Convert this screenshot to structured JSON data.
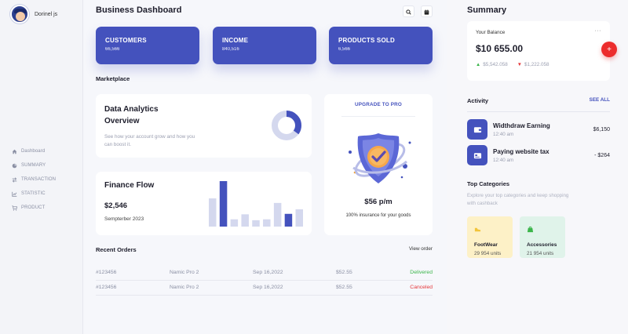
{
  "sidebar": {
    "profile_name": "Dorinel js",
    "items": [
      {
        "label": "Dashboard",
        "icon": "home-icon"
      },
      {
        "label": "SUMMARY",
        "icon": "pie-icon"
      },
      {
        "label": "TRANSACTION",
        "icon": "swap-icon"
      },
      {
        "label": "STATISTIC",
        "icon": "chart-icon"
      },
      {
        "label": "PRODUCT",
        "icon": "cart-icon"
      }
    ]
  },
  "header": {
    "title": "Business Dashboard",
    "actions": [
      {
        "icon": "search-icon"
      },
      {
        "icon": "calendar-icon"
      }
    ]
  },
  "stats": [
    {
      "label": "CUSTOMERS",
      "value": "66,566"
    },
    {
      "label": "INCOME",
      "value": "840,516"
    },
    {
      "label": "PRODUCTS SOLD",
      "value": "6,566"
    }
  ],
  "marketplace": {
    "label": "Marketplace",
    "analytics": {
      "title_line1": "Data Analytics",
      "title_line2": "Overview",
      "description": "See how your account grow and how you can boost it.",
      "donut_fraction": 0.35
    },
    "finance": {
      "title": "Finance Flow",
      "amount": "$2,546",
      "period": "Sempterber 2023",
      "bar_levels": [
        0.62,
        1.0,
        0.16,
        0.27,
        0.14,
        0.16,
        0.52,
        0.28,
        0.38
      ],
      "highlight_bars": [
        1,
        7
      ]
    },
    "upgrade": {
      "link": "UPGRADE TO PRO",
      "price": "$56 p/m",
      "note": "100% insurance for your goods"
    }
  },
  "orders": {
    "title": "Recent Orders",
    "view_link": "View order",
    "rows": [
      {
        "id": "#123456",
        "product": "Namic Pro 2",
        "date": "Sep 16,2022",
        "price": "$52.55",
        "status": "Delivered"
      },
      {
        "id": "#123456",
        "product": "Namic Pro 2",
        "date": "Sep 16,2022",
        "price": "$52.55",
        "status": "Canceled"
      }
    ]
  },
  "summary": {
    "title": "Summary",
    "balance_label": "Your Balance",
    "menu": "···",
    "balance": "$10 655.00",
    "income": "$5,542.058",
    "expense": "$1,222.058",
    "fab": "+"
  },
  "activity": {
    "title": "Activity",
    "see_all": "SEE ALL",
    "items": [
      {
        "name": "Widthdraw Earning",
        "time": "12:40 am",
        "amount": "$6,150",
        "icon": "wallet-icon"
      },
      {
        "name": "Paying website tax",
        "time": "12:40 am",
        "amount": "- $264",
        "icon": "card-icon"
      }
    ]
  },
  "categories": {
    "title": "Top Categories",
    "subtitle": "Explore your top categories and keep shopping with cashback",
    "items": [
      {
        "name": "FootWear",
        "units": "29 954 units",
        "bg": "#fdf1c7",
        "icon_color": "#f2c43a"
      },
      {
        "name": "Accessories",
        "units": "21 954 units",
        "bg": "#e0f3ea",
        "icon_color": "#3bb54a"
      }
    ]
  },
  "colors": {
    "accent": "#4452bd",
    "accent_light": "#d4d8ee",
    "success": "#3bb54a",
    "danger": "#e5373a"
  }
}
